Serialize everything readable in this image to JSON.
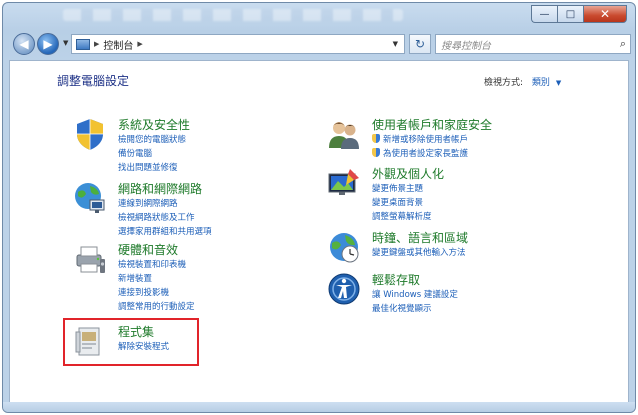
{
  "window": {
    "minimize_icon": "minimize-icon",
    "maximize_icon": "maximize-icon",
    "close_icon": "close-icon",
    "minimize_glyph": "—",
    "maximize_glyph": "□",
    "close_glyph": "✕"
  },
  "navbar": {
    "back_glyph": "◀",
    "forward_glyph": "▶",
    "address_crumb": "控制台",
    "refresh_glyph": "↻",
    "search_placeholder": "搜尋控制台",
    "search_glyph": "⌕"
  },
  "page": {
    "heading": "調整電腦設定",
    "view_by_label": "檢視方式:",
    "view_by_value": "類別",
    "view_by_caret": "▼"
  },
  "categories": [
    {
      "title": "系統及安全性",
      "links": [
        "檢閱您的電腦狀態",
        "備份電腦",
        "找出問題並修復"
      ],
      "icon": "shield-icon"
    },
    {
      "title": "網路和網際網路",
      "links": [
        "連線到網際網路",
        "檢視網路狀態及工作",
        "選擇家用群組和共用選項"
      ],
      "icon": "network-icon"
    },
    {
      "title": "硬體和音效",
      "links": [
        "檢視裝置和印表機",
        "新增裝置",
        "連接到投影機",
        "調整常用的行動設定"
      ],
      "icon": "printer-icon"
    },
    {
      "title": "程式集",
      "links": [
        "解除安裝程式"
      ],
      "icon": "programs-icon"
    },
    {
      "title": "使用者帳戶和家庭安全",
      "links": [
        "新增或移除使用者帳戶",
        "為使用者設定家長監護"
      ],
      "icon": "users-icon"
    },
    {
      "title": "外觀及個人化",
      "links": [
        "變更佈景主題",
        "變更桌面背景",
        "調整螢幕解析度"
      ],
      "icon": "display-icon"
    },
    {
      "title": "時鐘、語言和區域",
      "links": [
        "變更鍵盤或其他輸入方法"
      ],
      "icon": "globe-clock-icon"
    },
    {
      "title": "輕鬆存取",
      "links": [
        "讓 Windows 建議設定",
        "最佳化視覺顯示"
      ],
      "icon": "ease-of-access-icon"
    }
  ]
}
